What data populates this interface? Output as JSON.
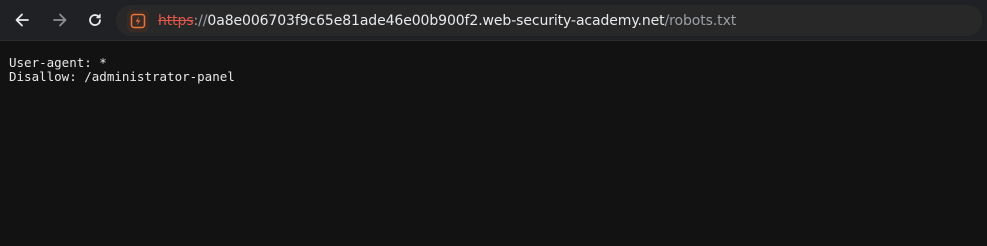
{
  "toolbar": {
    "back_icon": "arrow-left-icon",
    "forward_icon": "arrow-right-icon",
    "reload_icon": "reload-icon",
    "security_icon": "not-secure-lightning-icon",
    "url": {
      "scheme": "https",
      "separator": "://",
      "host": "0a8e006703f9c65e81ade46e00b900f2.web-security-academy.net",
      "path": "/robots.txt"
    }
  },
  "document": {
    "lines": [
      "User-agent: *",
      "Disallow: /administrator-panel"
    ]
  },
  "colors": {
    "background": "#121212",
    "toolbar": "#202124",
    "omnibox": "#282828",
    "insecure_scheme": "#e0584a",
    "security_icon": "#e8753a"
  }
}
